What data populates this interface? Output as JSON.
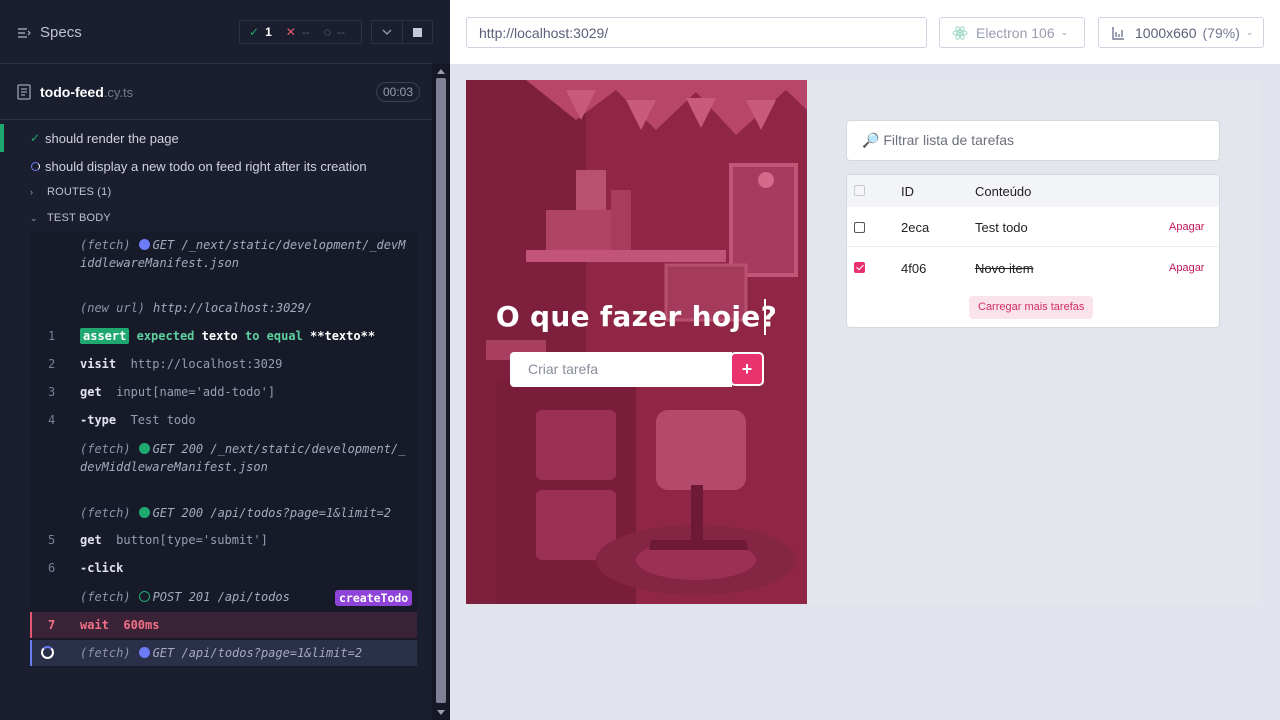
{
  "reporter": {
    "header": {
      "specs_label": "Specs",
      "passed_count": "1",
      "failed_count": "--",
      "pending_count": "--"
    },
    "spec": {
      "name": "todo-feed",
      "ext": ".cy.ts",
      "duration": "00:03"
    },
    "tests": [
      {
        "title": "should render the page",
        "state": "passed"
      },
      {
        "title": "should display a new todo on feed right after its creation",
        "state": "running"
      }
    ],
    "sections": {
      "routes": "ROUTES (1)",
      "test_body": "TEST BODY"
    },
    "commands": {
      "fetch_label": "(fetch)",
      "new_url_label": "(new url)",
      "f1": "GET /_next/static/development/_devMiddlewareManifest.json",
      "new_url": "http://localhost:3029/",
      "c1": {
        "num": "1",
        "badge": "assert",
        "pre": "expected",
        "val1": "texto",
        "mid": "to equal",
        "val2": "**texto**"
      },
      "c2": {
        "num": "2",
        "name": "visit",
        "msg": "http://localhost:3029"
      },
      "c3": {
        "num": "3",
        "name": "get",
        "msg": "input[name='add-todo']"
      },
      "c4": {
        "num": "4",
        "name": "-type",
        "msg": "Test todo"
      },
      "f2": "GET 200 /_next/static/development/_devMiddlewareManifest.json",
      "f3": "GET 200 /api/todos?page=1&limit=2",
      "c5": {
        "num": "5",
        "name": "get",
        "msg": "button[type='submit']"
      },
      "c6": {
        "num": "6",
        "name": "-click"
      },
      "f4": "POST 201 /api/todos",
      "alias": "createTodo",
      "c7": {
        "num": "7",
        "name": "wait",
        "msg": "600ms"
      },
      "f5": "GET /api/todos?page=1&limit=2"
    }
  },
  "aut": {
    "url": "http://localhost:3029/",
    "browser": "Electron 106",
    "viewport": "1000x660",
    "viewport_pct": "(79%)",
    "hero_title": "O que fazer hoje?",
    "todo_placeholder": "Criar tarefa",
    "add_label": "+",
    "filter_placeholder": "🔎 Filtrar lista de tarefas",
    "table": {
      "headers": {
        "id": "ID",
        "content": "Conteúdo"
      },
      "rows": [
        {
          "id": "2eca",
          "text": "Test todo",
          "done": false,
          "delete": "Apagar"
        },
        {
          "id": "4f06",
          "text": "Novo item",
          "done": true,
          "delete": "Apagar"
        }
      ],
      "load_more": "Carregar mais tarefas"
    }
  },
  "colors": {
    "accent": "#e8336f",
    "passed": "#1fa971",
    "failed": "#e45770",
    "pending_blue": "#6c7bf6",
    "alias_purple": "#8e44d8"
  },
  "icons": [
    "specs-icon",
    "check-icon",
    "cross-icon",
    "spinner-icon",
    "chevron-down-icon",
    "stop-icon",
    "file-icon",
    "electron-icon",
    "viewport-icon",
    "search-icon"
  ]
}
